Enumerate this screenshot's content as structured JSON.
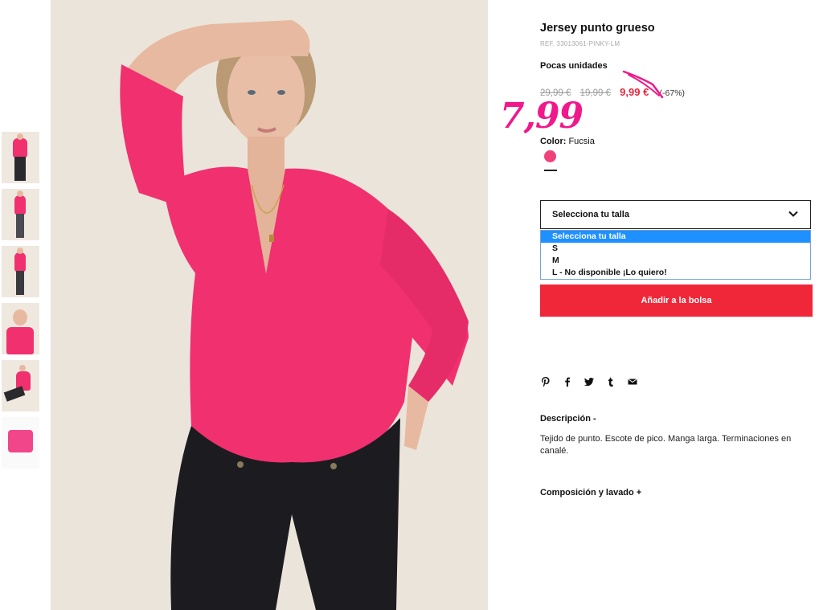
{
  "product": {
    "title": "Jersey punto grueso",
    "ref": "REF. 33013061-PINKY-LM",
    "stock": "Pocas unidades",
    "price_original": "29,99 €",
    "price_previous": "19,99 €",
    "price_current": "9,99 €",
    "discount": "(-67%)",
    "handwritten_price": "7,99",
    "color_label": "Color:",
    "color_value": "Fucsia",
    "color_hex": "#f0417a"
  },
  "size": {
    "placeholder": "Selecciona tu talla",
    "options": [
      "Selecciona tu talla",
      "S",
      "M",
      "L - No disponible ¡Lo quiero!"
    ],
    "selected_index": 0
  },
  "add_button": "Añadir a la bolsa",
  "share_icons": [
    "pinterest-icon",
    "facebook-icon",
    "twitter-icon",
    "tumblr-icon",
    "mail-icon"
  ],
  "description": {
    "heading": "Descripción -",
    "text": "Tejido de punto. Escote de pico. Manga larga. Terminaciones en canalé."
  },
  "composition_heading": "Composición y lavado +",
  "colors": {
    "accent_red": "#f02738",
    "price_red": "#e8263c",
    "handwritten_pink": "#f0188a",
    "sweater_pink": "#f1306f"
  }
}
